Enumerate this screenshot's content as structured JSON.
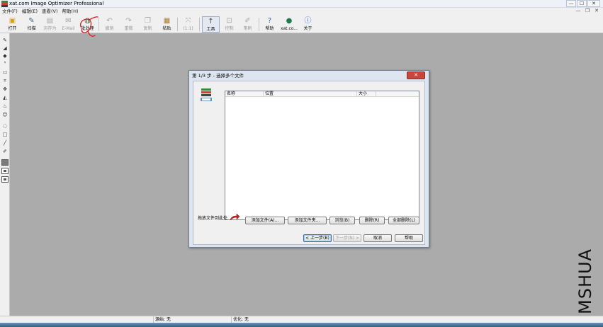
{
  "window": {
    "title": "xat.com Image Optimizer Professional",
    "controls": {
      "minimize": "—",
      "maximize": "☐",
      "close": "✕"
    }
  },
  "menubar": {
    "items": [
      "文件(F)",
      "编辑(E)",
      "查看(V)",
      "帮助(H)"
    ],
    "mdi_controls": {
      "minimize": "—",
      "restore": "❐",
      "close": "✕"
    }
  },
  "toolbar": {
    "buttons": [
      {
        "label": "打开",
        "icon": "open-folder-icon",
        "enabled": true
      },
      {
        "label": "扫描",
        "icon": "scan-icon",
        "enabled": true
      },
      {
        "label": "另存为",
        "icon": "save-as-icon",
        "enabled": false
      },
      {
        "label": "E-Mail",
        "icon": "email-icon",
        "enabled": false
      },
      {
        "label": "批处理",
        "icon": "batch-icon",
        "enabled": true
      },
      {
        "label": "撤销",
        "icon": "undo-icon",
        "enabled": false
      },
      {
        "label": "重做",
        "icon": "redo-icon",
        "enabled": false
      },
      {
        "label": "复制",
        "icon": "copy-icon",
        "enabled": false
      },
      {
        "label": "粘贴",
        "icon": "paste-icon",
        "enabled": true
      },
      {
        "label": "(1:1)",
        "icon": "zoom-actual-icon",
        "enabled": false
      },
      {
        "label": "工具",
        "icon": "tools-icon",
        "enabled": true
      },
      {
        "label": "控制",
        "icon": "control-icon",
        "enabled": false
      },
      {
        "label": "笔刷",
        "icon": "brush-icon",
        "enabled": false
      },
      {
        "label": "帮助",
        "icon": "help-icon",
        "enabled": true
      },
      {
        "label": "xat.co...",
        "icon": "globe-icon",
        "enabled": true
      },
      {
        "label": "关于",
        "icon": "info-icon",
        "enabled": true
      }
    ]
  },
  "dialog": {
    "title": "第 1/3 步 - 选择多个文件",
    "close_label": "✕",
    "list": {
      "columns": [
        "名称",
        "位置",
        "大小"
      ],
      "rows": []
    },
    "drop_hint": "拖放文件到此处",
    "file_buttons": {
      "add_file": "添加文件(A)...",
      "add_folder": "添加文件夹...",
      "browse": "浏览(B)",
      "remove": "删除(R)",
      "remove_all": "全部删除(L)"
    },
    "nav_buttons": {
      "back": "< 上一步(B)",
      "next": "下一步(N) >",
      "cancel": "取消",
      "help": "帮助"
    }
  },
  "statusbar": {
    "source": "源始: 无",
    "optimized": "优化: 无"
  },
  "watermark": "MSHUA",
  "colors": {
    "workspace": "#ababab",
    "dialog_frame": "#dde6f0",
    "close_button": "#c9463d",
    "annotation_red": "#d81e1e"
  }
}
